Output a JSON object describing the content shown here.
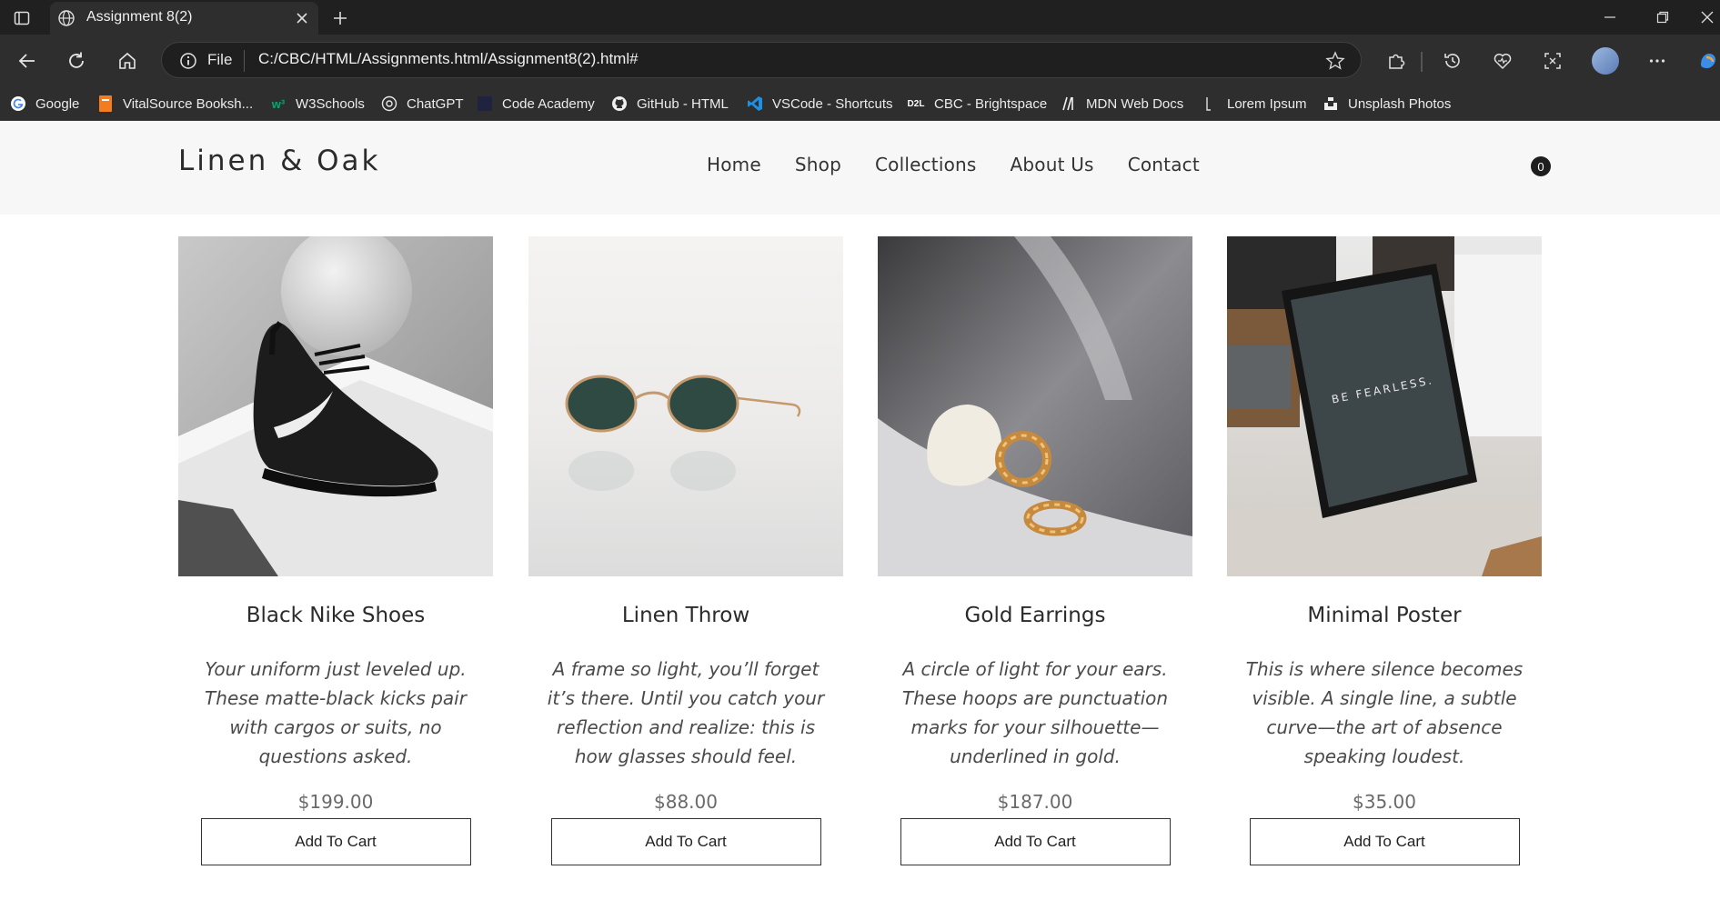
{
  "browser": {
    "tab_title": "Assignment 8(2)",
    "address_scheme": "File",
    "url": "C:/CBC/HTML/Assignments.html/Assignment8(2).html#",
    "bookmarks": [
      {
        "label": "Google",
        "icon": "google-icon"
      },
      {
        "label": "VitalSource Booksh...",
        "icon": "vitalsource-icon"
      },
      {
        "label": "W3Schools",
        "icon": "w3schools-icon"
      },
      {
        "label": "ChatGPT",
        "icon": "chatgpt-icon"
      },
      {
        "label": "Code Academy",
        "icon": "codecademy-icon"
      },
      {
        "label": "GitHub - HTML",
        "icon": "github-icon"
      },
      {
        "label": "VSCode - Shortcuts",
        "icon": "vscode-icon"
      },
      {
        "label": "CBC - Brightspace",
        "icon": "d2l-icon"
      },
      {
        "label": "MDN Web Docs",
        "icon": "mdn-icon"
      },
      {
        "label": "Lorem Ipsum",
        "icon": "lorem-icon"
      },
      {
        "label": "Unsplash Photos",
        "icon": "unsplash-icon"
      }
    ],
    "d2l_badge": "D2L"
  },
  "site": {
    "logo": "Linen & Oak",
    "nav": [
      "Home",
      "Shop",
      "Collections",
      "About Us",
      "Contact"
    ],
    "cart_count": "0"
  },
  "products": [
    {
      "name": "Black Nike Shoes",
      "description": "Your uniform just leveled up. These matte-black kicks pair with cargos or suits, no questions asked.",
      "price": "$199.00",
      "button": "Add To Cart",
      "image": "black-sneaker-photo"
    },
    {
      "name": "Linen Throw",
      "description": "A frame so light, you’ll forget it’s there. Until you catch your reflection and realize: this is how glasses should feel.",
      "price": "$88.00",
      "button": "Add To Cart",
      "image": "sunglasses-photo"
    },
    {
      "name": "Gold Earrings",
      "description": "A circle of light for your ears. These hoops are punctuation marks for your silhouette—underlined in gold.",
      "price": "$187.00",
      "button": "Add To Cart",
      "image": "gold-hoops-photo"
    },
    {
      "name": "Minimal Poster",
      "description": "This is where silence becomes visible. A single line, a subtle curve—the art of absence speaking loudest.",
      "price": "$35.00",
      "button": "Add To Cart",
      "image": "framed-poster-photo",
      "poster_text": "BE FEARLESS."
    }
  ]
}
